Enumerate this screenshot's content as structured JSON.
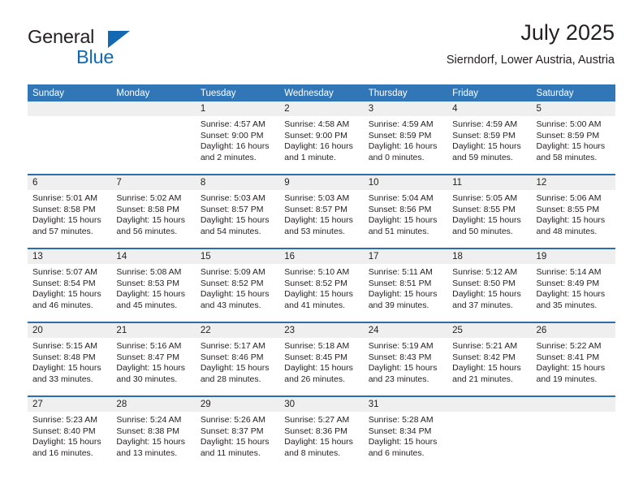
{
  "brand": {
    "name_part1": "General",
    "name_part2": "Blue",
    "triangle_color": "#1268b3",
    "text_color": "#231f20"
  },
  "header": {
    "title": "July 2025",
    "subtitle": "Sierndorf, Lower Austria, Austria"
  },
  "theme": {
    "header_blue": "#3177b8",
    "row_divider_blue": "#2f6cab",
    "day_band_gray": "#efefef",
    "text": "#231f20"
  },
  "weekdays": [
    "Sunday",
    "Monday",
    "Tuesday",
    "Wednesday",
    "Thursday",
    "Friday",
    "Saturday"
  ],
  "weeks": [
    [
      {
        "day": "",
        "lines": []
      },
      {
        "day": "",
        "lines": []
      },
      {
        "day": "1",
        "lines": [
          "Sunrise: 4:57 AM",
          "Sunset: 9:00 PM",
          "Daylight: 16 hours",
          "and 2 minutes."
        ]
      },
      {
        "day": "2",
        "lines": [
          "Sunrise: 4:58 AM",
          "Sunset: 9:00 PM",
          "Daylight: 16 hours",
          "and 1 minute."
        ]
      },
      {
        "day": "3",
        "lines": [
          "Sunrise: 4:59 AM",
          "Sunset: 8:59 PM",
          "Daylight: 16 hours",
          "and 0 minutes."
        ]
      },
      {
        "day": "4",
        "lines": [
          "Sunrise: 4:59 AM",
          "Sunset: 8:59 PM",
          "Daylight: 15 hours",
          "and 59 minutes."
        ]
      },
      {
        "day": "5",
        "lines": [
          "Sunrise: 5:00 AM",
          "Sunset: 8:59 PM",
          "Daylight: 15 hours",
          "and 58 minutes."
        ]
      }
    ],
    [
      {
        "day": "6",
        "lines": [
          "Sunrise: 5:01 AM",
          "Sunset: 8:58 PM",
          "Daylight: 15 hours",
          "and 57 minutes."
        ]
      },
      {
        "day": "7",
        "lines": [
          "Sunrise: 5:02 AM",
          "Sunset: 8:58 PM",
          "Daylight: 15 hours",
          "and 56 minutes."
        ]
      },
      {
        "day": "8",
        "lines": [
          "Sunrise: 5:03 AM",
          "Sunset: 8:57 PM",
          "Daylight: 15 hours",
          "and 54 minutes."
        ]
      },
      {
        "day": "9",
        "lines": [
          "Sunrise: 5:03 AM",
          "Sunset: 8:57 PM",
          "Daylight: 15 hours",
          "and 53 minutes."
        ]
      },
      {
        "day": "10",
        "lines": [
          "Sunrise: 5:04 AM",
          "Sunset: 8:56 PM",
          "Daylight: 15 hours",
          "and 51 minutes."
        ]
      },
      {
        "day": "11",
        "lines": [
          "Sunrise: 5:05 AM",
          "Sunset: 8:55 PM",
          "Daylight: 15 hours",
          "and 50 minutes."
        ]
      },
      {
        "day": "12",
        "lines": [
          "Sunrise: 5:06 AM",
          "Sunset: 8:55 PM",
          "Daylight: 15 hours",
          "and 48 minutes."
        ]
      }
    ],
    [
      {
        "day": "13",
        "lines": [
          "Sunrise: 5:07 AM",
          "Sunset: 8:54 PM",
          "Daylight: 15 hours",
          "and 46 minutes."
        ]
      },
      {
        "day": "14",
        "lines": [
          "Sunrise: 5:08 AM",
          "Sunset: 8:53 PM",
          "Daylight: 15 hours",
          "and 45 minutes."
        ]
      },
      {
        "day": "15",
        "lines": [
          "Sunrise: 5:09 AM",
          "Sunset: 8:52 PM",
          "Daylight: 15 hours",
          "and 43 minutes."
        ]
      },
      {
        "day": "16",
        "lines": [
          "Sunrise: 5:10 AM",
          "Sunset: 8:52 PM",
          "Daylight: 15 hours",
          "and 41 minutes."
        ]
      },
      {
        "day": "17",
        "lines": [
          "Sunrise: 5:11 AM",
          "Sunset: 8:51 PM",
          "Daylight: 15 hours",
          "and 39 minutes."
        ]
      },
      {
        "day": "18",
        "lines": [
          "Sunrise: 5:12 AM",
          "Sunset: 8:50 PM",
          "Daylight: 15 hours",
          "and 37 minutes."
        ]
      },
      {
        "day": "19",
        "lines": [
          "Sunrise: 5:14 AM",
          "Sunset: 8:49 PM",
          "Daylight: 15 hours",
          "and 35 minutes."
        ]
      }
    ],
    [
      {
        "day": "20",
        "lines": [
          "Sunrise: 5:15 AM",
          "Sunset: 8:48 PM",
          "Daylight: 15 hours",
          "and 33 minutes."
        ]
      },
      {
        "day": "21",
        "lines": [
          "Sunrise: 5:16 AM",
          "Sunset: 8:47 PM",
          "Daylight: 15 hours",
          "and 30 minutes."
        ]
      },
      {
        "day": "22",
        "lines": [
          "Sunrise: 5:17 AM",
          "Sunset: 8:46 PM",
          "Daylight: 15 hours",
          "and 28 minutes."
        ]
      },
      {
        "day": "23",
        "lines": [
          "Sunrise: 5:18 AM",
          "Sunset: 8:45 PM",
          "Daylight: 15 hours",
          "and 26 minutes."
        ]
      },
      {
        "day": "24",
        "lines": [
          "Sunrise: 5:19 AM",
          "Sunset: 8:43 PM",
          "Daylight: 15 hours",
          "and 23 minutes."
        ]
      },
      {
        "day": "25",
        "lines": [
          "Sunrise: 5:21 AM",
          "Sunset: 8:42 PM",
          "Daylight: 15 hours",
          "and 21 minutes."
        ]
      },
      {
        "day": "26",
        "lines": [
          "Sunrise: 5:22 AM",
          "Sunset: 8:41 PM",
          "Daylight: 15 hours",
          "and 19 minutes."
        ]
      }
    ],
    [
      {
        "day": "27",
        "lines": [
          "Sunrise: 5:23 AM",
          "Sunset: 8:40 PM",
          "Daylight: 15 hours",
          "and 16 minutes."
        ]
      },
      {
        "day": "28",
        "lines": [
          "Sunrise: 5:24 AM",
          "Sunset: 8:38 PM",
          "Daylight: 15 hours",
          "and 13 minutes."
        ]
      },
      {
        "day": "29",
        "lines": [
          "Sunrise: 5:26 AM",
          "Sunset: 8:37 PM",
          "Daylight: 15 hours",
          "and 11 minutes."
        ]
      },
      {
        "day": "30",
        "lines": [
          "Sunrise: 5:27 AM",
          "Sunset: 8:36 PM",
          "Daylight: 15 hours",
          "and 8 minutes."
        ]
      },
      {
        "day": "31",
        "lines": [
          "Sunrise: 5:28 AM",
          "Sunset: 8:34 PM",
          "Daylight: 15 hours",
          "and 6 minutes."
        ]
      },
      {
        "day": "",
        "lines": []
      },
      {
        "day": "",
        "lines": []
      }
    ]
  ]
}
